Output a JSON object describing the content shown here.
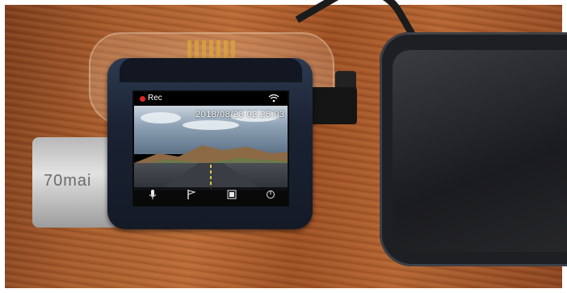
{
  "device": {
    "brand": "70mai",
    "screen": {
      "status_label": "Rec",
      "timestamp": "2018/08/23 02:25:03",
      "icons": [
        "microphone-icon",
        "flag-icon",
        "photo-icon",
        "power-icon"
      ]
    }
  },
  "colors": {
    "dashboard_wood": "#a45a2c",
    "device_body": "#1a2233",
    "rec_indicator": "#e02424",
    "brand_stick": "#c8c8c8"
  }
}
